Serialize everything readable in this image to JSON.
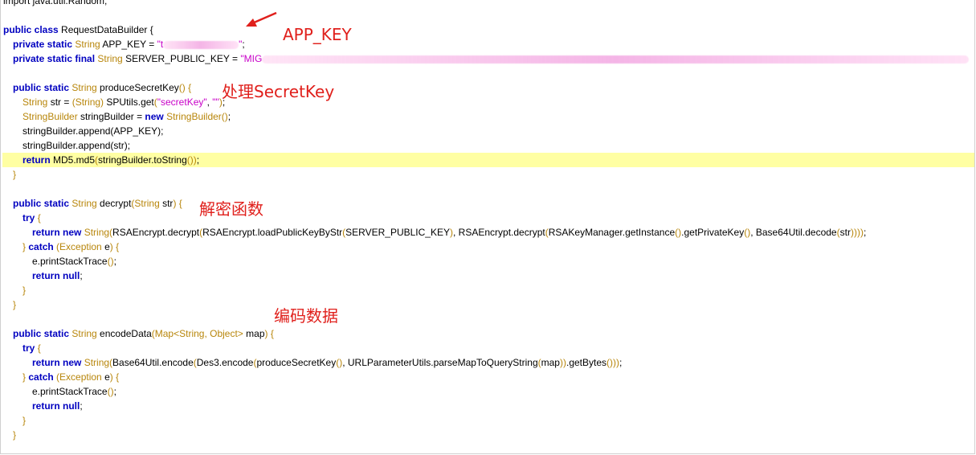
{
  "editor": {
    "lines": [
      {
        "id": "import",
        "hl": false,
        "indent": 0,
        "tokens": [
          {
            "t": "plain",
            "v": "import java.util.Random;"
          }
        ]
      },
      {
        "id": "blank1",
        "hl": false,
        "indent": 0,
        "tokens": []
      },
      {
        "id": "class-decl",
        "hl": false,
        "indent": 0,
        "tokens": [
          {
            "t": "kw",
            "v": "public class "
          },
          {
            "t": "plain",
            "v": "RequestDataBuilder {"
          }
        ]
      },
      {
        "id": "app-key",
        "hl": false,
        "indent": 1,
        "tokens": [
          {
            "t": "kw",
            "v": "private static "
          },
          {
            "t": "ty",
            "v": "String "
          },
          {
            "t": "plain",
            "v": "APP_KEY = "
          },
          {
            "t": "st",
            "v": "\"t"
          },
          {
            "t": "redact",
            "w": 94
          },
          {
            "t": "st",
            "v": "\""
          },
          {
            "t": "plain",
            "v": ";"
          }
        ]
      },
      {
        "id": "server-key",
        "hl": false,
        "indent": 1,
        "tokens": [
          {
            "t": "kw",
            "v": "private static final "
          },
          {
            "t": "ty",
            "v": "String "
          },
          {
            "t": "plain",
            "v": "SERVER_PUBLIC_KEY = "
          },
          {
            "t": "st",
            "v": "\"MIG"
          },
          {
            "t": "redact",
            "w": 880
          }
        ]
      },
      {
        "id": "blank2",
        "hl": false,
        "indent": 0,
        "tokens": []
      },
      {
        "id": "psk-decl",
        "hl": false,
        "indent": 1,
        "tokens": [
          {
            "t": "kw",
            "v": "public static "
          },
          {
            "t": "ty",
            "v": "String "
          },
          {
            "t": "plain",
            "v": "produceSecretKey"
          },
          {
            "t": "ty",
            "v": "() {"
          }
        ]
      },
      {
        "id": "psk-str",
        "hl": false,
        "indent": 2,
        "tokens": [
          {
            "t": "ty",
            "v": "String "
          },
          {
            "t": "plain",
            "v": "str = "
          },
          {
            "t": "ty",
            "v": "(String) "
          },
          {
            "t": "plain",
            "v": "SPUtils.get"
          },
          {
            "t": "ty",
            "v": "("
          },
          {
            "t": "st",
            "v": "\"secretKey\""
          },
          {
            "t": "plain",
            "v": ", "
          },
          {
            "t": "st",
            "v": "\"\""
          },
          {
            "t": "ty",
            "v": ")"
          },
          {
            "t": "plain",
            "v": ";"
          }
        ]
      },
      {
        "id": "psk-sb",
        "hl": false,
        "indent": 2,
        "tokens": [
          {
            "t": "ty",
            "v": "StringBuilder "
          },
          {
            "t": "plain",
            "v": "stringBuilder = "
          },
          {
            "t": "kw",
            "v": "new "
          },
          {
            "t": "ty",
            "v": "StringBuilder()"
          },
          {
            "t": "plain",
            "v": ";"
          }
        ]
      },
      {
        "id": "psk-append1",
        "hl": false,
        "indent": 2,
        "tokens": [
          {
            "t": "plain",
            "v": "stringBuilder.append(APP_KEY);"
          }
        ]
      },
      {
        "id": "psk-append2",
        "hl": false,
        "indent": 2,
        "tokens": [
          {
            "t": "plain",
            "v": "stringBuilder.append(str);"
          }
        ]
      },
      {
        "id": "psk-return",
        "hl": true,
        "indent": 2,
        "tokens": [
          {
            "t": "kw",
            "v": "return "
          },
          {
            "t": "plain",
            "v": "MD5.md5"
          },
          {
            "t": "ty",
            "v": "("
          },
          {
            "t": "plain",
            "v": "stringBuilder.toString"
          },
          {
            "t": "ty",
            "v": "())"
          },
          {
            "t": "plain",
            "v": ";"
          }
        ]
      },
      {
        "id": "psk-close",
        "hl": false,
        "indent": 1,
        "tokens": [
          {
            "t": "ty",
            "v": "}"
          }
        ]
      },
      {
        "id": "blank3",
        "hl": false,
        "indent": 0,
        "tokens": []
      },
      {
        "id": "dec-decl",
        "hl": false,
        "indent": 1,
        "tokens": [
          {
            "t": "kw",
            "v": "public static "
          },
          {
            "t": "ty",
            "v": "String "
          },
          {
            "t": "plain",
            "v": "decrypt"
          },
          {
            "t": "ty",
            "v": "(String "
          },
          {
            "t": "plain",
            "v": "str"
          },
          {
            "t": "ty",
            "v": ") {"
          }
        ]
      },
      {
        "id": "dec-try",
        "hl": false,
        "indent": 2,
        "tokens": [
          {
            "t": "kw",
            "v": "try "
          },
          {
            "t": "ty",
            "v": "{"
          }
        ]
      },
      {
        "id": "dec-return",
        "hl": false,
        "indent": 3,
        "tokens": [
          {
            "t": "kw",
            "v": "return new "
          },
          {
            "t": "ty",
            "v": "String("
          },
          {
            "t": "plain",
            "v": "RSAEncrypt.decrypt"
          },
          {
            "t": "ty",
            "v": "("
          },
          {
            "t": "plain",
            "v": "RSAEncrypt.loadPublicKeyByStr"
          },
          {
            "t": "ty",
            "v": "("
          },
          {
            "t": "plain",
            "v": "SERVER_PUBLIC_KEY"
          },
          {
            "t": "ty",
            "v": ")"
          },
          {
            "t": "plain",
            "v": ", RSAEncrypt.decrypt"
          },
          {
            "t": "ty",
            "v": "("
          },
          {
            "t": "plain",
            "v": "RSAKeyManager.getInstance"
          },
          {
            "t": "ty",
            "v": "()"
          },
          {
            "t": "plain",
            "v": ".getPrivateKey"
          },
          {
            "t": "ty",
            "v": "()"
          },
          {
            "t": "plain",
            "v": ", Base64Util.decode"
          },
          {
            "t": "ty",
            "v": "("
          },
          {
            "t": "plain",
            "v": "str"
          },
          {
            "t": "ty",
            "v": "))))"
          },
          {
            "t": "plain",
            "v": ";"
          }
        ]
      },
      {
        "id": "dec-catch",
        "hl": false,
        "indent": 2,
        "tokens": [
          {
            "t": "ty",
            "v": "} "
          },
          {
            "t": "kw",
            "v": "catch "
          },
          {
            "t": "ty",
            "v": "(Exception "
          },
          {
            "t": "plain",
            "v": "e"
          },
          {
            "t": "ty",
            "v": ") {"
          }
        ]
      },
      {
        "id": "dec-print",
        "hl": false,
        "indent": 3,
        "tokens": [
          {
            "t": "plain",
            "v": "e.printStackTrace"
          },
          {
            "t": "ty",
            "v": "()"
          },
          {
            "t": "plain",
            "v": ";"
          }
        ]
      },
      {
        "id": "dec-null",
        "hl": false,
        "indent": 3,
        "tokens": [
          {
            "t": "kw",
            "v": "return null"
          },
          {
            "t": "plain",
            "v": ";"
          }
        ]
      },
      {
        "id": "dec-catch-close",
        "hl": false,
        "indent": 2,
        "tokens": [
          {
            "t": "ty",
            "v": "}"
          }
        ]
      },
      {
        "id": "dec-close",
        "hl": false,
        "indent": 1,
        "tokens": [
          {
            "t": "ty",
            "v": "}"
          }
        ]
      },
      {
        "id": "blank4",
        "hl": false,
        "indent": 0,
        "tokens": []
      },
      {
        "id": "enc-decl",
        "hl": false,
        "indent": 1,
        "tokens": [
          {
            "t": "kw",
            "v": "public static "
          },
          {
            "t": "ty",
            "v": "String "
          },
          {
            "t": "plain",
            "v": "encodeData"
          },
          {
            "t": "ty",
            "v": "(Map<String, Object> "
          },
          {
            "t": "plain",
            "v": "map"
          },
          {
            "t": "ty",
            "v": ") {"
          }
        ]
      },
      {
        "id": "enc-try",
        "hl": false,
        "indent": 2,
        "tokens": [
          {
            "t": "kw",
            "v": "try "
          },
          {
            "t": "ty",
            "v": "{"
          }
        ]
      },
      {
        "id": "enc-return",
        "hl": false,
        "indent": 3,
        "tokens": [
          {
            "t": "kw",
            "v": "return new "
          },
          {
            "t": "ty",
            "v": "String("
          },
          {
            "t": "plain",
            "v": "Base64Util.encode"
          },
          {
            "t": "ty",
            "v": "("
          },
          {
            "t": "plain",
            "v": "Des3.encode"
          },
          {
            "t": "ty",
            "v": "("
          },
          {
            "t": "plain",
            "v": "produceSecretKey"
          },
          {
            "t": "ty",
            "v": "()"
          },
          {
            "t": "plain",
            "v": ", URLParameterUtils.parseMapToQueryString"
          },
          {
            "t": "ty",
            "v": "("
          },
          {
            "t": "plain",
            "v": "map"
          },
          {
            "t": "ty",
            "v": "))"
          },
          {
            "t": "plain",
            "v": ".getBytes"
          },
          {
            "t": "ty",
            "v": "()))"
          },
          {
            "t": "plain",
            "v": ";"
          }
        ]
      },
      {
        "id": "enc-catch",
        "hl": false,
        "indent": 2,
        "tokens": [
          {
            "t": "ty",
            "v": "} "
          },
          {
            "t": "kw",
            "v": "catch "
          },
          {
            "t": "ty",
            "v": "(Exception "
          },
          {
            "t": "plain",
            "v": "e"
          },
          {
            "t": "ty",
            "v": ") {"
          }
        ]
      },
      {
        "id": "enc-print",
        "hl": false,
        "indent": 3,
        "tokens": [
          {
            "t": "plain",
            "v": "e.printStackTrace"
          },
          {
            "t": "ty",
            "v": "()"
          },
          {
            "t": "plain",
            "v": ";"
          }
        ]
      },
      {
        "id": "enc-null",
        "hl": false,
        "indent": 3,
        "tokens": [
          {
            "t": "kw",
            "v": "return null"
          },
          {
            "t": "plain",
            "v": ";"
          }
        ]
      },
      {
        "id": "enc-catch-close",
        "hl": false,
        "indent": 2,
        "tokens": [
          {
            "t": "ty",
            "v": "}"
          }
        ]
      },
      {
        "id": "enc-close",
        "hl": false,
        "indent": 1,
        "tokens": [
          {
            "t": "ty",
            "v": "}"
          }
        ]
      }
    ]
  },
  "annotations": {
    "app_key": "APP_KEY",
    "secret_key": "处理SecretKey",
    "decrypt": "解密函数",
    "encode": "编码数据"
  },
  "colors": {
    "keyword": "#0000c0",
    "type": "#b8860b",
    "string": "#c800c8",
    "highlight": "#ffffa3",
    "annotation": "#e0201c"
  }
}
